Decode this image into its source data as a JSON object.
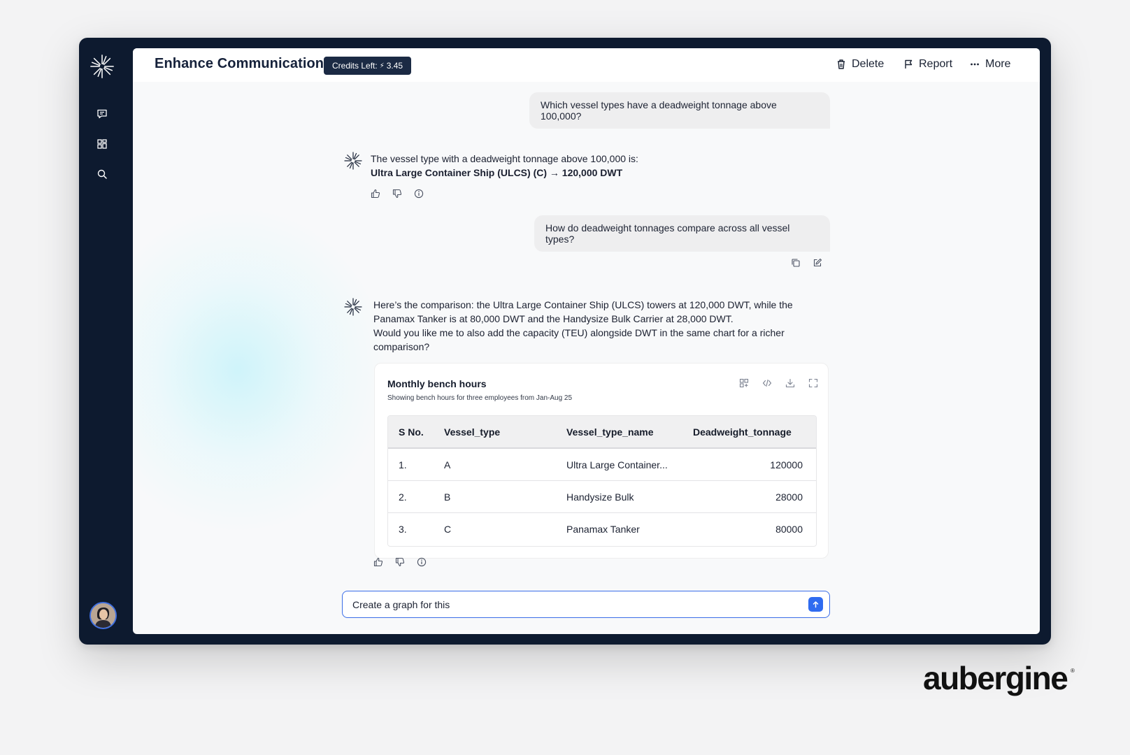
{
  "header": {
    "title": "Enhance Communication",
    "credits_label": "Credits Left:",
    "credits_bolt": "⚡",
    "credits_value": "3.45",
    "actions": {
      "delete": "Delete",
      "report": "Report",
      "more": "More"
    }
  },
  "sidebar": {
    "icons": [
      "new-chat-icon",
      "dashboard-icon",
      "search-icon"
    ]
  },
  "conversation": {
    "user_1": "Which vessel types have a deadweight tonnage above 100,000?",
    "bot_1_line1": "The vessel type with a deadweight tonnage above 100,000 is:",
    "bot_1_line2": "Ultra Large Container Ship (ULCS) (C) → 120,000 DWT",
    "user_2": "How do deadweight tonnages compare across all vessel types?",
    "bot_2_line1": "Here’s the comparison: the Ultra Large Container Ship (ULCS) towers at 120,000 DWT, while the",
    "bot_2_line2": "Panamax Tanker is at 80,000 DWT and the Handysize Bulk Carrier at 28,000 DWT.",
    "bot_2_line3": "Would you like me to also add the capacity (TEU) alongside DWT in the same chart for a richer",
    "bot_2_line4": "comparison?"
  },
  "table_card": {
    "title": "Monthly bench hours",
    "subtitle": "Showing  bench hours for three employees from Jan-Aug 25",
    "columns": [
      "S No.",
      "Vessel_type",
      "Vessel_type_name",
      "Deadweight_tonnage"
    ],
    "rows": [
      [
        "1.",
        "A",
        "Ultra Large Container...",
        "120000"
      ],
      [
        "2.",
        "B",
        "Handysize Bulk",
        "28000"
      ],
      [
        "3.",
        "C",
        "Panamax Tanker",
        "80000"
      ]
    ]
  },
  "composer": {
    "value": "Create a graph for this"
  },
  "brand": {
    "name": "aubergine",
    "mark": "®"
  },
  "colors": {
    "frame": "#0d1a2f",
    "accent": "#2f6bf0",
    "badge": "#1b2a44"
  }
}
